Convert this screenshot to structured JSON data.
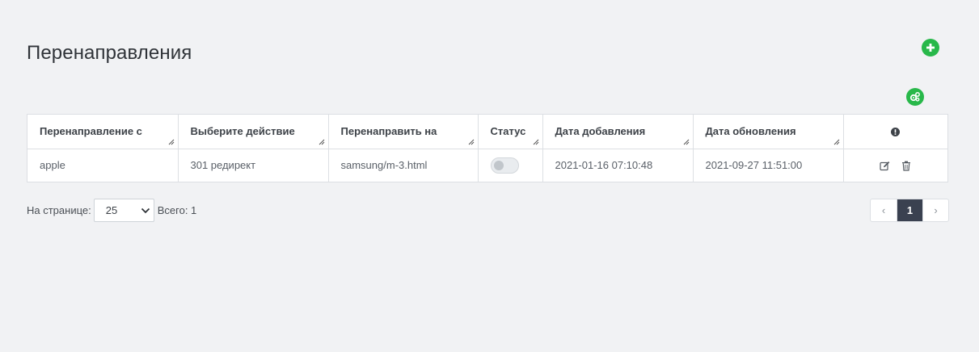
{
  "page": {
    "title": "Перенаправления"
  },
  "toolbar": {
    "add_icon": "plus-circle-icon",
    "settings_icon": "gears-icon",
    "accent_color": "#28b84a"
  },
  "table": {
    "columns": [
      "Перенаправление с",
      "Выберите действие",
      "Перенаправить на",
      "Статус",
      "Дата добавления",
      "Дата обновления"
    ],
    "actions_header_icon": "info-circle-icon",
    "rows": [
      {
        "from": "apple",
        "action": "301 редирект",
        "to": "samsung/m-3.html",
        "status_enabled": false,
        "date_added": "2021-01-16 07:10:48",
        "date_updated": "2021-09-27 11:51:00",
        "edit_icon": "edit-icon",
        "delete_icon": "trash-icon"
      }
    ]
  },
  "footer": {
    "per_page_label": "На странице:",
    "per_page_value": "25",
    "total_label": "Всего: 1"
  },
  "pagination": {
    "prev": "‹",
    "current": "1",
    "next": "›",
    "active_color": "#3a4150"
  }
}
